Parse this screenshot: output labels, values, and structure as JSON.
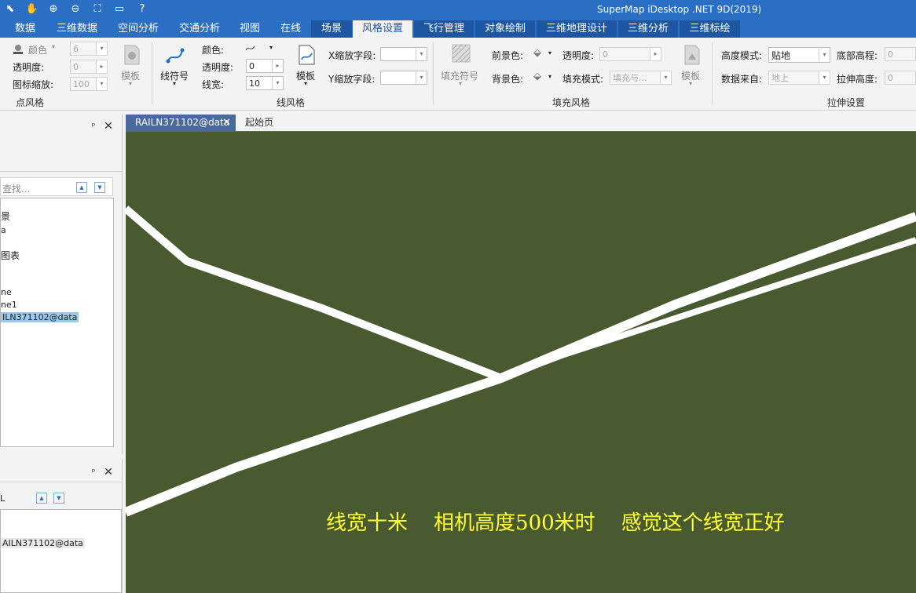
{
  "app_title": "SuperMap iDesktop .NET 9D(2019)",
  "menu": [
    "数据",
    "三维数据",
    "空间分析",
    "交通分析",
    "视图",
    "在线",
    "场景",
    "风格设置",
    "飞行管理",
    "对象绘制",
    "三维地理设计",
    "三维分析",
    "三维标绘"
  ],
  "active_menu": "风格设置",
  "ribbon": {
    "point_style": {
      "color_label": "颜色",
      "size_value": "6",
      "opacity_label": "透明度:",
      "opacity_value": "0",
      "icon_scale_label": "图标缩放:",
      "icon_scale_value": "100",
      "template_label": "模板",
      "group_label": "点风格"
    },
    "line_style": {
      "line_symbol_label": "线符号",
      "color_label": "颜色:",
      "opacity_label": "透明度:",
      "opacity_value": "0",
      "width_label": "线宽:",
      "width_value": "10",
      "template_label": "模板",
      "x_scale_label": "X缩放字段:",
      "y_scale_label": "Y缩放字段:",
      "group_label": "线风格"
    },
    "fill_style": {
      "fill_symbol_label": "填充符号",
      "fg_color_label": "前景色:",
      "bg_color_label": "背景色:",
      "opacity_label": "透明度:",
      "opacity_value": "0",
      "fill_mode_label": "填充模式:",
      "fill_mode_value": "填充与...",
      "template_label": "模板",
      "group_label": "填充风格"
    },
    "extrude": {
      "height_mode_label": "高度模式:",
      "height_mode_value": "贴地",
      "data_source_label": "数据来自:",
      "data_source_value": "地上",
      "bottom_elev_label": "底部高程:",
      "bottom_elev_value": "0",
      "extrude_height_label": "拉伸高度:",
      "extrude_height_value": "0",
      "group_label": "拉伸设置"
    }
  },
  "left_panel_top": {
    "search_placeholder": "查找...",
    "items": [
      "景",
      "a",
      "图表",
      "ne",
      "ne1",
      "ILN371102@data"
    ]
  },
  "left_panel_bottom": {
    "search_text": "L",
    "items": [
      "AILN371102@data"
    ]
  },
  "doc_tabs": [
    "RAILN371102@data",
    "起始页"
  ],
  "scene_caption": "线宽十米    相机高度500米时    感觉这个线宽正好",
  "colors": {
    "title_bar": "#2b6fc4",
    "scene_bg": "#4a5a30",
    "caption": "#ffff33",
    "selection": "#99c9ef"
  }
}
